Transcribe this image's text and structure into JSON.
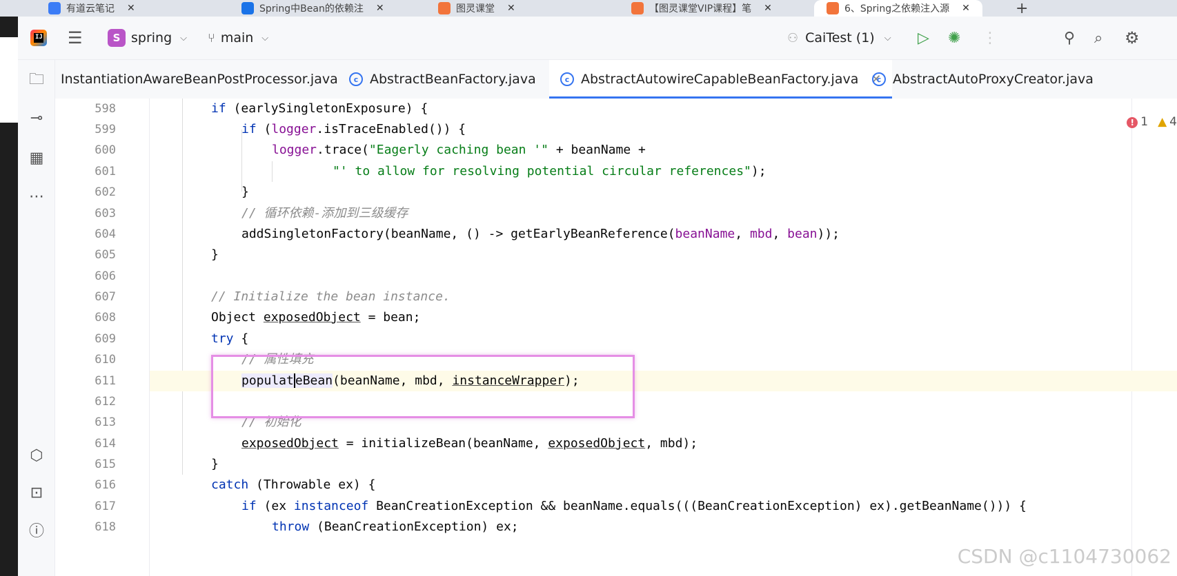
{
  "browser_tabs": [
    {
      "title": "有道云笔记",
      "icon_color": "#3b7cf6",
      "active": false
    },
    {
      "title": "Spring中Bean的依赖注",
      "icon_color": "#1a73e8",
      "active": false
    },
    {
      "title": "图灵课堂",
      "icon_color": "#f2743b",
      "active": false
    },
    {
      "title": "【图灵课堂VIP课程】笔",
      "icon_color": "#f2743b",
      "active": false
    },
    {
      "title": "6、Spring之依赖注入源",
      "icon_color": "#f2743b",
      "active": true
    }
  ],
  "toolbar": {
    "project_initial": "S",
    "project_name": "spring",
    "branch_name": "main",
    "run_config": "CaiTest (1)"
  },
  "editor_tabs": [
    {
      "label": "InstantiationAwareBeanPostProcessor.java",
      "active": false
    },
    {
      "label": "AbstractBeanFactory.java",
      "active": false
    },
    {
      "label": "AbstractAutowireCapableBeanFactory.java",
      "active": true
    },
    {
      "label": "AbstractAutoProxyCreator.java",
      "active": false
    }
  ],
  "inspections": {
    "errors": "1",
    "warnings": "4"
  },
  "line_numbers": [
    "598",
    "599",
    "600",
    "601",
    "602",
    "603",
    "604",
    "605",
    "606",
    "607",
    "608",
    "609",
    "610",
    "611",
    "612",
    "613",
    "614",
    "615",
    "616",
    "617",
    "618"
  ],
  "code": {
    "l598": {
      "kw": "if",
      "rest": " (earlySingletonExposure) {"
    },
    "l599": {
      "kw": "if",
      "p1": " (",
      "fld": "logger",
      "rest": ".isTraceEnabled()) {"
    },
    "l600": {
      "fld": "logger",
      "p1": ".trace(",
      "str": "\"Eagerly caching bean '\"",
      "rest": " + beanName +"
    },
    "l601": {
      "str": "\"' to allow for resolving potential circular references\"",
      "rest": ");"
    },
    "l602": {
      "text": "}"
    },
    "l603": {
      "comment": "// 循环依赖-添加到三级缓存"
    },
    "l604": {
      "p1": "addSingletonFactory(beanName, () -> getEarlyBeanReference(",
      "f1": "beanName",
      "s1": ", ",
      "f2": "mbd",
      "s2": ", ",
      "f3": "bean",
      "rest": "));"
    },
    "l605": {
      "text": "}"
    },
    "l607": {
      "comment": "// Initialize the bean instance."
    },
    "l608": {
      "p1": "Object ",
      "var": "exposedObject",
      "rest": " = bean;"
    },
    "l609": {
      "kw": "try",
      "rest": " {"
    },
    "l610": {
      "comment": "// 属性填充"
    },
    "l611": {
      "hl_a": "populat",
      "hl_b": "eBean",
      "p1": "(beanName, mbd, ",
      "var": "instanceWrapper",
      "rest": ");"
    },
    "l613": {
      "comment": "// 初始化"
    },
    "l614": {
      "var1": "exposedObject",
      "p1": " = initializeBean(beanName, ",
      "var2": "exposedObject",
      "rest": ", mbd);"
    },
    "l615": {
      "text": "}"
    },
    "l616": {
      "kw": "catch",
      "rest": " (Throwable ex) {"
    },
    "l617": {
      "kw": "if",
      "p1": " (ex ",
      "kw2": "instanceof",
      "rest": " BeanCreationException && beanName.equals(((BeanCreationException) ex).getBeanName())) {"
    },
    "l618": {
      "kw": "throw",
      "rest": " (BeanCreationException) ex;"
    }
  },
  "watermark": "CSDN @c1104730062",
  "colors": {
    "accent": "#3574f0",
    "keyword": "#0033b3",
    "field": "#871094",
    "string": "#067d17",
    "comment": "#8c8c8c",
    "highlight_box": "#e58ee5"
  }
}
